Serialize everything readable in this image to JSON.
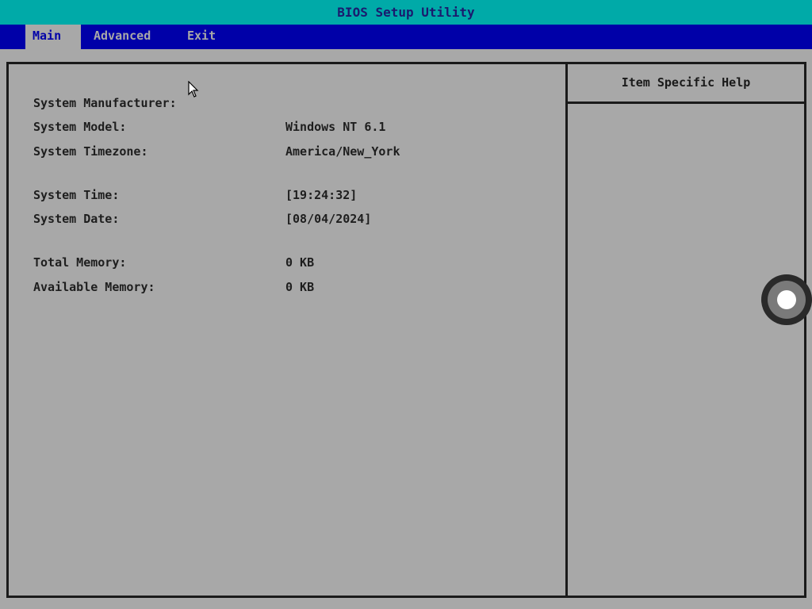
{
  "app": {
    "title": "BIOS Setup Utility"
  },
  "menu": {
    "items": [
      {
        "label": "Main",
        "active": true
      },
      {
        "label": "Advanced",
        "active": false
      },
      {
        "label": "Exit",
        "active": false
      }
    ]
  },
  "main": {
    "rows": [
      {
        "label": "System Manufacturer:",
        "value": ""
      },
      {
        "label": "System Model:",
        "value": "Windows NT 6.1"
      },
      {
        "label": "System Timezone:",
        "value": "America/New_York"
      },
      {
        "label": "System Time:",
        "value": "[19:24:32]"
      },
      {
        "label": "System Date:",
        "value": "[08/04/2024]"
      },
      {
        "label": "Total Memory:",
        "value": "0 KB"
      },
      {
        "label": "Available Memory:",
        "value": "0 KB"
      }
    ]
  },
  "help": {
    "title": "Item Specific Help"
  },
  "colors": {
    "title_bar": "#00aaa8",
    "menu_bar": "#0000a8",
    "background": "#a8a8a8",
    "border": "#1a1a1a"
  },
  "icons": {
    "pointer": "mouse-pointer-icon",
    "knob": "scroll-knob-icon"
  }
}
